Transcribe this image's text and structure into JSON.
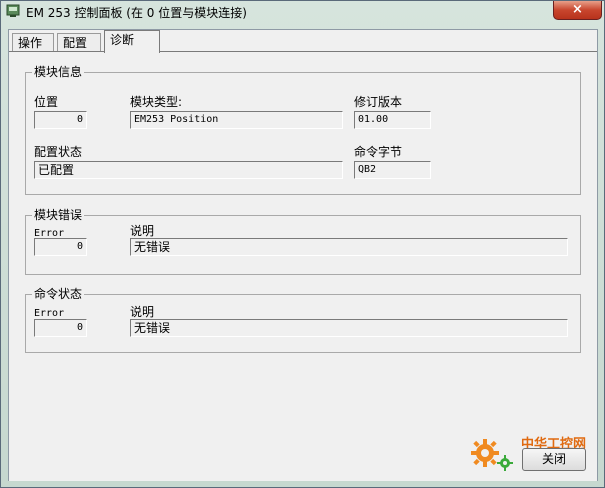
{
  "window": {
    "title": "EM 253 控制面板 (在 0 位置与模块连接)",
    "close_symbol": "×"
  },
  "tabs": [
    {
      "label": "操作"
    },
    {
      "label": "配置"
    },
    {
      "label": "诊断",
      "active": true
    }
  ],
  "module_info": {
    "title": "模块信息",
    "position_label": "位置",
    "position_value": "0",
    "type_label": "模块类型:",
    "type_value": "EM253 Position",
    "revision_label": "修订版本",
    "revision_value": "01.00",
    "config_status_label": "配置状态",
    "config_status_value": "已配置",
    "command_byte_label": "命令字节",
    "command_byte_value": "QB2"
  },
  "module_error": {
    "title": "模块错误",
    "error_label": "Error",
    "error_value": "0",
    "desc_label": "说明",
    "desc_value": "无错误"
  },
  "command_status": {
    "title": "命令状态",
    "error_label": "Error",
    "error_value": "0",
    "desc_label": "说明",
    "desc_value": "无错误"
  },
  "close_button_label": "关闭",
  "watermark": {
    "text": "中华工控网",
    "icon": "gear-icon",
    "color": "#e06a10"
  }
}
